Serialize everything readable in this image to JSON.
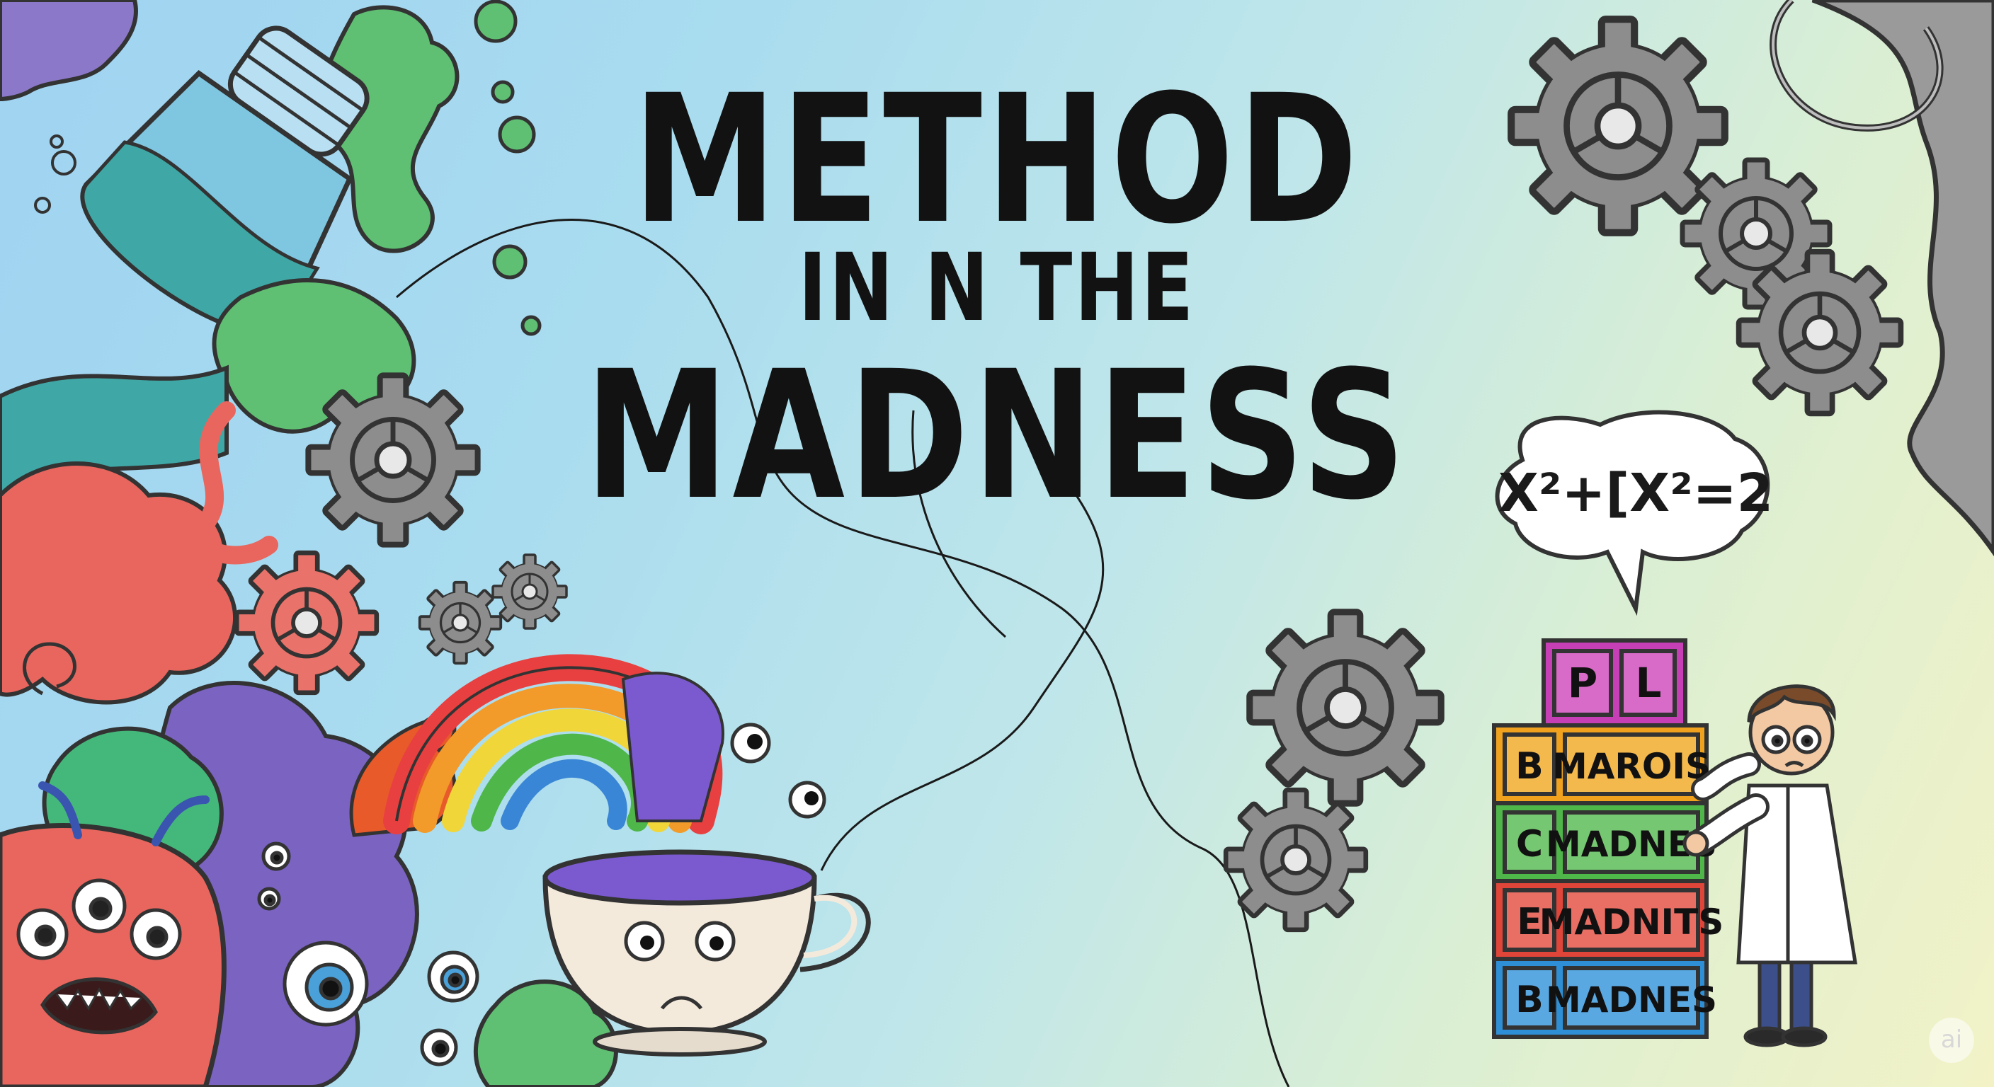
{
  "title": {
    "line1": "METHOD",
    "line2": "IN N THE",
    "line3": "MADNESS"
  },
  "speech_bubble": {
    "text": "X²+[X²=2"
  },
  "blocks": {
    "top": {
      "left": "P",
      "right": "L",
      "color": "#c63fb5"
    },
    "rows": [
      {
        "letter": "B",
        "label": "MAROIS",
        "color": "#f0a21f"
      },
      {
        "letter": "C",
        "label": "MADNES",
        "color": "#4fb64a"
      },
      {
        "letter": "E",
        "label": "MADNITS",
        "color": "#e0453a"
      },
      {
        "letter": "B",
        "label": "MADNES",
        "color": "#2f8fd6"
      }
    ]
  },
  "watermark": {
    "text": "ai"
  },
  "icons": [
    "potion-bottle-icon",
    "gear-icon",
    "rainbow-cup-icon",
    "monster-icon",
    "scientist-icon",
    "letter-blocks-icon",
    "speech-bubble-icon"
  ]
}
